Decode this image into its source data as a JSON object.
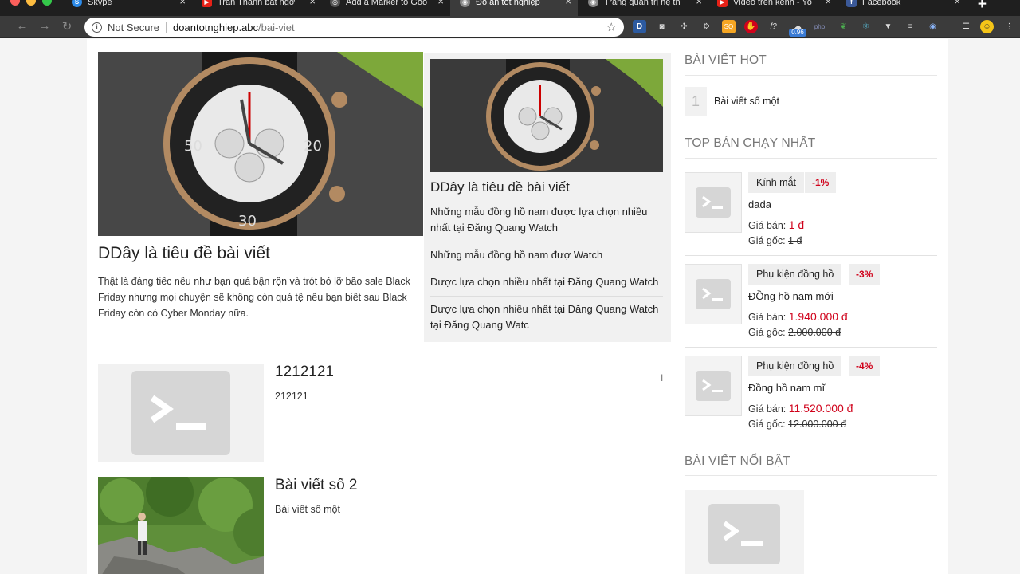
{
  "browser": {
    "tabs": [
      {
        "title": "Skype",
        "icon": "skype-icon",
        "color": "#2d8ceb"
      },
      {
        "title": "Trấn Thành bất ngờ",
        "icon": "youtube-icon",
        "color": "#e62117"
      },
      {
        "title": "Add a Marker to Goo",
        "icon": "globe-icon",
        "color": "#cccccc"
      },
      {
        "title": "Đồ án tốt nghiệp",
        "icon": "site-icon",
        "color": "#dddddd"
      },
      {
        "title": "Trang quản trị hệ th",
        "icon": "site-icon",
        "color": "#dddddd"
      },
      {
        "title": "Video trên kênh - Yo",
        "icon": "youtube-icon",
        "color": "#e62117"
      },
      {
        "title": "Facebook",
        "icon": "facebook-icon",
        "color": "#3b5998"
      }
    ],
    "active_tab_index": 3,
    "new_tab_symbol": "+",
    "address": {
      "security_label": "Not Secure",
      "domain": "doantotnghiep.abc",
      "path": "/bai-viet"
    },
    "extension_badge": "0.96"
  },
  "featured_post": {
    "title": "DDây là tiêu đề bài viết",
    "description": "Thật là đáng tiếc nếu như bạn quá bận rộn và trót bỏ lỡ bão sale Black Friday nhưng mọi chuyện sẽ không còn quá tệ nếu bạn biết sau Black Friday còn có Cyber Monday nữa."
  },
  "side_post": {
    "title": "DDây là tiêu đề bài viết",
    "links": [
      "Những mẫu đồng hồ nam được lựa chọn nhiều nhất tại Đăng Quang Watch",
      "Những mẫu đồng hồ nam đượ Watch",
      "Dược lựa chọn nhiều nhất tại Đăng Quang Watch",
      "Dược lựa chọn nhiều nhất tại Đăng Quang Watch tại Đăng Quang Watc"
    ]
  },
  "posts": [
    {
      "title": "1212121",
      "description": "212121"
    },
    {
      "title": "Bài viết số 2",
      "description": "Bài viết số một"
    }
  ],
  "sidebar": {
    "hot_heading": "BÀI VIẾT HOT",
    "hot_items": [
      {
        "number": "1",
        "title": "Bài viết số một"
      }
    ],
    "best_heading": "TOP BÁN CHẠY NHẤT",
    "price_label": "Giá bán:",
    "orig_label": "Giá gốc:",
    "products": [
      {
        "category": "Kính mắt",
        "discount": "-1%",
        "name": "dada",
        "price": "1 đ",
        "original": "1 đ"
      },
      {
        "category": "Phụ kiện đồng hồ",
        "discount": "-3%",
        "name": "ĐỒng hồ nam mới",
        "price": "1.940.000 đ",
        "original": "2.000.000 đ"
      },
      {
        "category": "Phụ kiện đồng hồ",
        "discount": "-4%",
        "name": "Đồng hồ nam mĩ",
        "price": "11.520.000 đ",
        "original": "12.000.000 đ"
      }
    ],
    "featured_heading": "BÀI VIẾT NỔI BẬT"
  },
  "colors": {
    "accent_red": "#d0021b",
    "heading_grey": "#777777"
  }
}
